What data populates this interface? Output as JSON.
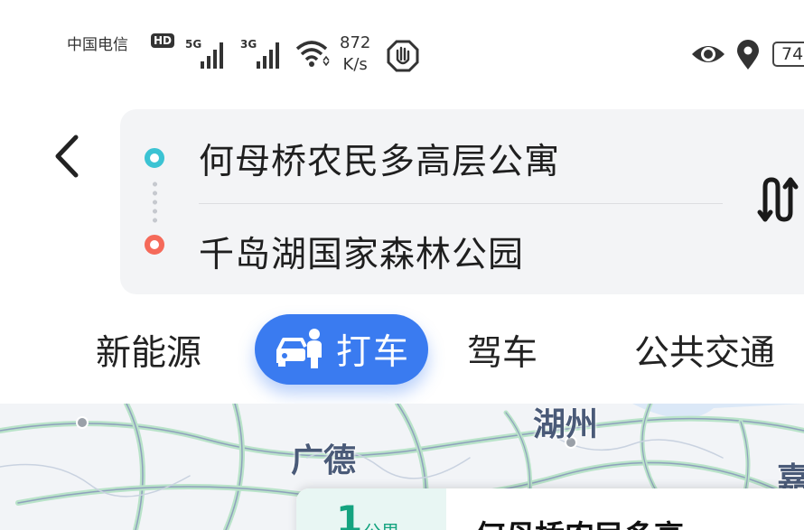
{
  "status_bar": {
    "carrier": "中国电信",
    "hd_badge": "HD",
    "network_1": "5G",
    "network_2": "3G",
    "speed_value": "872",
    "speed_unit": "K/s",
    "battery": "74",
    "icons": [
      "signal-icon",
      "wifi-icon",
      "hand-icon",
      "eye-icon",
      "location-pin-icon",
      "battery-icon"
    ]
  },
  "route": {
    "origin": "何母桥农民多高层公寓",
    "destination": "千岛湖国家森林公园",
    "back_icon": "back-arrow-icon",
    "swap_icon": "swap-icon"
  },
  "tabs": {
    "ev": "新能源",
    "taxi": "打车",
    "drive": "驾车",
    "transit": "公共交通",
    "active": "taxi",
    "active_color": "#3a7bf0"
  },
  "map": {
    "labels": {
      "guangde": "广德",
      "huzhou": "湖州",
      "jia": "嘉"
    }
  },
  "bottom_card": {
    "number": "1",
    "unit": "公里",
    "title": "何母桥农民多高"
  }
}
